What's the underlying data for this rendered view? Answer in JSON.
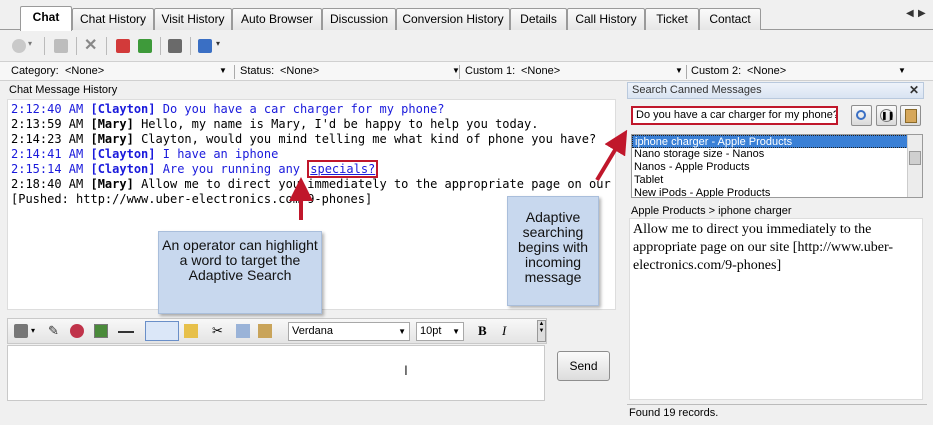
{
  "tabs": [
    {
      "label": "Chat",
      "active": true
    },
    {
      "label": "Chat History"
    },
    {
      "label": "Visit History"
    },
    {
      "label": "Auto Browser"
    },
    {
      "label": "Discussion"
    },
    {
      "label": "Conversion History"
    },
    {
      "label": "Details"
    },
    {
      "label": "Call History"
    },
    {
      "label": "Ticket"
    },
    {
      "label": "Contact"
    }
  ],
  "tab_nav": {
    "prev": "◀",
    "next": "▶"
  },
  "filters": {
    "category": {
      "label": "Category:",
      "value": "<None>"
    },
    "status": {
      "label": "Status:",
      "value": "<None>"
    },
    "custom1": {
      "label": "Custom 1:",
      "value": "<None>"
    },
    "custom2": {
      "label": "Custom 2:",
      "value": "<None>"
    }
  },
  "chat": {
    "title": "Chat Message History",
    "messages": [
      {
        "time": "2:12:40 AM",
        "who": "[Clayton]",
        "text": "Do you have a car charger for my phone?",
        "color": "#1a1adc"
      },
      {
        "time": "2:13:59 AM",
        "who": "[Mary]",
        "text": "Hello, my name is Mary, I'd be happy to help you today.",
        "color": "#000000"
      },
      {
        "time": "2:14:23 AM",
        "who": "[Mary]",
        "text": "Clayton, would you mind telling me what kind of phone you have?",
        "color": "#000000"
      },
      {
        "time": "2:14:41 AM",
        "who": "[Clayton]",
        "text": "I have an iphone",
        "color": "#1a1adc"
      },
      {
        "time": "2:15:14 AM",
        "who": "[Clayton]",
        "text_before": "Are you running any ",
        "highlight": "specials?",
        "color": "#1a1adc"
      },
      {
        "time": "2:18:40 AM",
        "who": "[Mary]",
        "text": "Allow me to direct you immediately to the appropriate page on our site",
        "color": "#000000"
      },
      {
        "pushed": "[Pushed: http://www.uber-electronics.com/9-phones]"
      }
    ]
  },
  "editor": {
    "font": "Verdana",
    "size": "10pt",
    "bold": "B",
    "italic": "I",
    "send_label": "Send"
  },
  "canned": {
    "header": "Search Canned Messages",
    "close": "✕",
    "search_value": "Do you have a car charger for my phone?",
    "items": [
      "iphone charger - Apple Products",
      "Nano storage size - Nanos",
      "Nanos - Apple Products",
      "Tablet",
      "New iPods - Apple Products"
    ],
    "path": "Apple Products > iphone charger",
    "body": "Allow me to direct you immediately to the appropriate page on our site [http://www.uber-electronics.com/9-phones]",
    "found": "Found 19 records."
  },
  "callouts": {
    "operator": "An operator can highlight a word to target the Adaptive Search",
    "adaptive": "Adaptive searching begins with incoming message"
  },
  "colors": {
    "highlight_red": "#c0172b",
    "customer_blue": "#1a1adc",
    "selection_blue": "#3a80d6",
    "callout_bg": "#c8d8ee"
  }
}
